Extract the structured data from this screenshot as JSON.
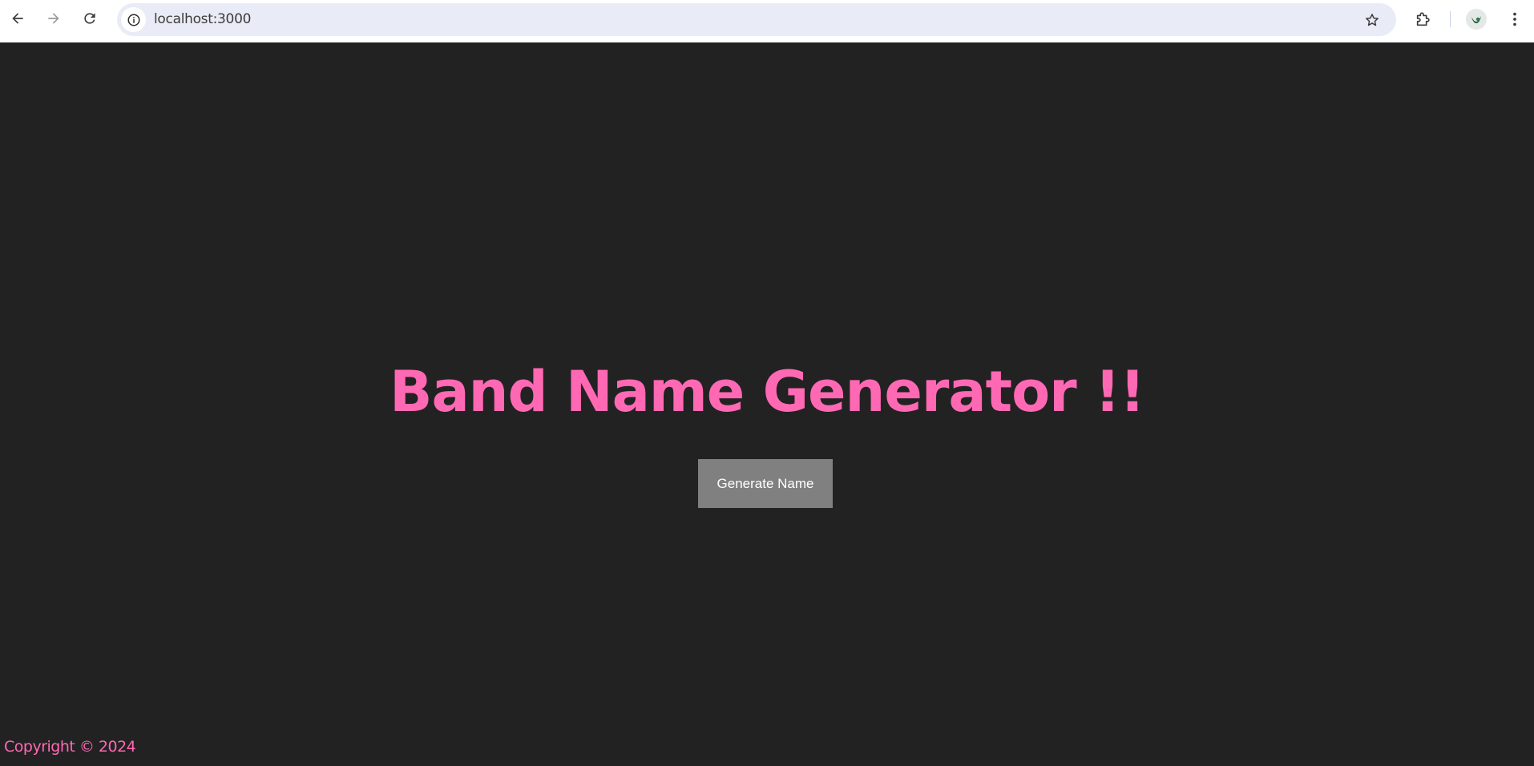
{
  "browser": {
    "url": "localhost:3000",
    "icons": {
      "back": "back-arrow-icon",
      "forward": "forward-arrow-icon",
      "reload": "reload-icon",
      "site_info": "info-icon",
      "bookmark": "star-icon",
      "extensions": "puzzle-icon",
      "profile": "avatar",
      "menu": "kebab-menu-icon"
    }
  },
  "page": {
    "title": "Band Name Generator !!",
    "button_label": "Generate Name",
    "footer": "Copyright © 2024"
  },
  "colors": {
    "background": "#222222",
    "accent": "#ff69b4",
    "button": "#808080"
  }
}
